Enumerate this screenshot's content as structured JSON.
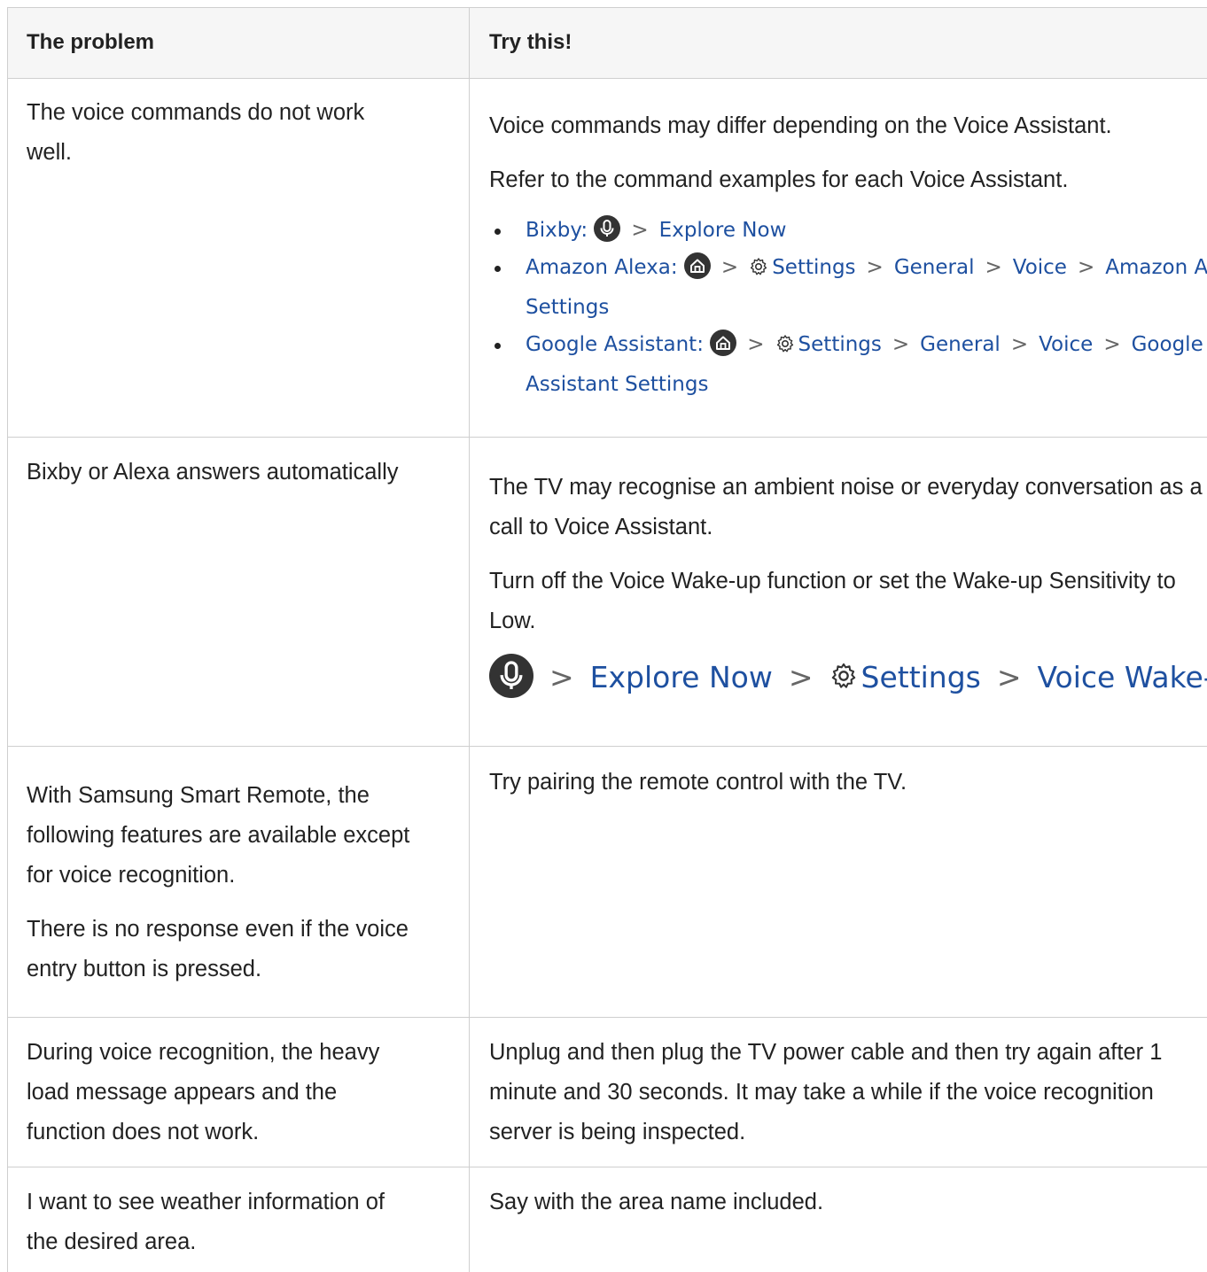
{
  "header": {
    "problem_label": "The problem",
    "solution_label": "Try this!"
  },
  "rows": [
    {
      "problem": [
        "The voice commands do not work",
        "well."
      ],
      "solution_text": [
        "Voice commands may differ depending on the Voice Assistant.",
        "Refer to the command examples for each Voice Assistant."
      ],
      "paths": [
        {
          "name": "Bixby",
          "line1": [
            "Explore Now"
          ],
          "line2": []
        },
        {
          "name": "Amazon Alexa",
          "line1": [
            "Settings",
            "General",
            "Voice",
            "Amazon Alexa"
          ],
          "line2": [
            "Settings"
          ]
        },
        {
          "name": "Google Assistant",
          "line1": [
            "Settings",
            "General",
            "Voice",
            "Google"
          ],
          "line2": [
            "Assistant Settings"
          ]
        }
      ]
    },
    {
      "problem": [
        "Bixby or Alexa answers automatically"
      ],
      "solution_text": [
        "The TV may recognise an ambient noise or everyday conversation as a",
        "call to Voice Assistant.",
        "Turn off the Voice Wake-up function or set the Wake-up Sensitivity to",
        "Low."
      ],
      "big_path": [
        "Explore Now",
        "Settings",
        "Voice Wake-up"
      ]
    },
    {
      "problem": [
        "With Samsung Smart Remote, the",
        "following features are available except",
        "for voice recognition.",
        "There is no response even if the voice",
        "entry button is pressed."
      ],
      "solution_text": [
        "Try pairing the remote control with the TV."
      ]
    },
    {
      "problem": [
        "During voice recognition, the heavy",
        "load message appears and the",
        "function does not work."
      ],
      "solution_text": [
        "Unplug and then plug the TV power cable and then try again after 1",
        "minute and 30 seconds. It may take a while if the voice recognition",
        "server is being inspected."
      ]
    },
    {
      "problem": [
        "I want to see weather information of",
        "the desired area."
      ],
      "solution_text": [
        "Say with the area name included."
      ]
    }
  ],
  "colors": {
    "link": "#1e50a0",
    "border": "#cfcfcf",
    "header_bg": "#f6f6f6",
    "icon_bg": "#333333"
  },
  "icons": [
    "mic-icon",
    "home-icon",
    "gear-icon",
    "chevron-right-icon"
  ]
}
